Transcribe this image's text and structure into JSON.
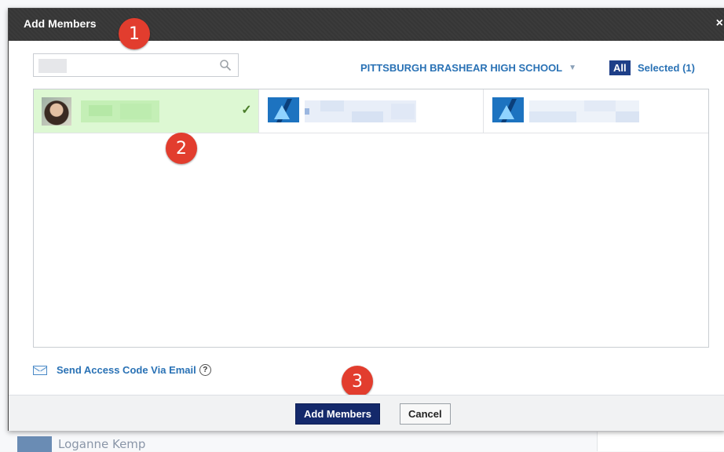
{
  "modal": {
    "title": "Add Members",
    "close_glyph": "×"
  },
  "steps": [
    "1",
    "2",
    "3"
  ],
  "search": {
    "value": "",
    "icon": "search-icon"
  },
  "filter": {
    "school": "PITTSBURGH BRASHEAR HIGH SCHOOL",
    "all_label": "All",
    "selected_label": "Selected (1)"
  },
  "members": [
    {
      "avatar": "photo",
      "selected": true,
      "check": "✓"
    },
    {
      "avatar": "school-logo",
      "selected": false
    },
    {
      "avatar": "school-logo",
      "selected": false
    }
  ],
  "send_code": {
    "label": "Send Access Code Via Email",
    "help": "?"
  },
  "footer": {
    "add_label": "Add Members",
    "cancel_label": "Cancel"
  },
  "background": {
    "row_name": "Loganne Kemp"
  },
  "colors": {
    "accent": "#2a72b5",
    "primary_button": "#14296b",
    "selected_row": "#ddf8d3",
    "step_badge": "#e23d2e"
  }
}
